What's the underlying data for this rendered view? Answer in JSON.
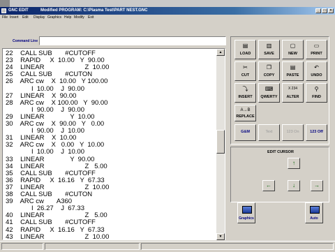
{
  "window": {
    "app_title": "GNC EDIT",
    "doc_title": "Modified PROGRAM: C:\\Plasma Test\\PART NEST.GNC",
    "min_icon": "_",
    "max_icon": "□",
    "close_icon": "×"
  },
  "menu": [
    "File",
    "Insert",
    "Edit",
    "Display",
    "Graphics",
    "Help",
    "Modify",
    "Exit"
  ],
  "command": {
    "label": "Command Line",
    "value": ""
  },
  "code_lines": [
    "22    CALL SUB       #CUTOFF",
    "23    RAPID     X  10.00   Y  90.00",
    "24    LINEAR                      Z  10.00",
    "25    CALL SUB       #CUTON",
    "26    ARC cw    X  10.00   Y 100.00",
    "              I  10.00    J  90.00",
    "27    LINEAR    X  90.00",
    "28    ARC cw    X 100.00   Y  90.00",
    "              I  90.00    J  90.00",
    "29    LINEAR              Y  10.00",
    "30    ARC cw    X  90.00   Y   0.00",
    "              I  90.00    J  10.00",
    "31    LINEAR    X  10.00",
    "32    ARC cw    X   0.00   Y  10.00",
    "              I  10.00    J  10.00",
    "33    LINEAR              Y  90.00",
    "34    LINEAR                      Z   5.00",
    "35    CALL SUB       #CUTOFF",
    "36    RAPID     X  16.16   Y  67.33",
    "37    LINEAR                      Z  10.00",
    "38    CALL SUB       #CUTON",
    "39    ARC cw       A360",
    "              I  26.27    J  67.33",
    "40    LINEAR                      Z   5.00",
    "41    CALL SUB       #CUTOFF",
    "42    RAPID     X  16.16   Y  67.33",
    "43    LINEAR                      Z  10.00"
  ],
  "scrollbar": {
    "up_icon": "▲",
    "down_icon": "▼"
  },
  "toolbar": {
    "load": {
      "label": "LOAD",
      "icon": "▤"
    },
    "save": {
      "label": "SAVE",
      "icon": "▥"
    },
    "new": {
      "label": "NEW",
      "icon": "▢"
    },
    "print": {
      "label": "PRINT",
      "icon": "▭"
    },
    "cut": {
      "label": "CUT",
      "icon": "✂"
    },
    "copy": {
      "label": "COPY",
      "icon": "❐"
    },
    "paste": {
      "label": "PASTE",
      "icon": "▤"
    },
    "undo": {
      "label": "UNDO",
      "icon": "↶"
    },
    "insert": {
      "label": "INSERT",
      "icon": "⤵"
    },
    "qwerty": {
      "label": "QWERTY",
      "icon": "⌨"
    },
    "alter": {
      "label": "ALTER",
      "icon": "X 234"
    },
    "find": {
      "label": "FIND",
      "icon": "⚲"
    },
    "replace": {
      "label": "REPLACE",
      "icon": "A→B"
    },
    "gm": {
      "label": "G&M"
    },
    "text": {
      "label": "Text"
    },
    "n123on": {
      "label": "123 On"
    },
    "n123off": {
      "label": "123 Off"
    }
  },
  "edit_cursor": {
    "title": "EDIT CURSOR",
    "up": "↑",
    "left": "←",
    "down": "↓",
    "right": "→"
  },
  "bottom_buttons": {
    "graphics": "Graphics",
    "auto": "Auto"
  }
}
